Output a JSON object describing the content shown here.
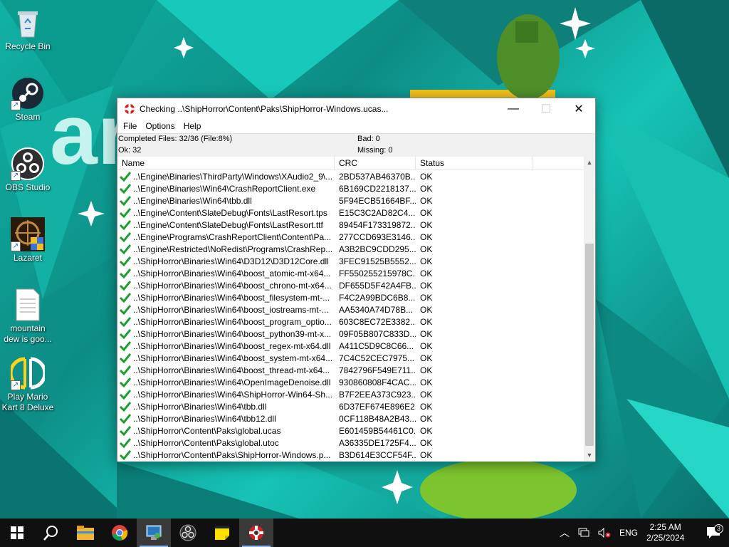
{
  "desktop": {
    "icons": [
      {
        "label": "Recycle Bin",
        "icon": "recycle-bin-icon"
      },
      {
        "label": "Steam",
        "icon": "steam-icon"
      },
      {
        "label": "OBS Studio",
        "icon": "obs-icon"
      },
      {
        "label": "Lazaret",
        "icon": "lazaret-icon"
      },
      {
        "label": "mountain dew is goo...",
        "icon": "text-file-icon"
      },
      {
        "label": "Play Mario Kart 8 Deluxe",
        "icon": "yuzu-icon"
      }
    ]
  },
  "window": {
    "title": "Checking ..\\ShipHorror\\Content\\Paks\\ShipHorror-Windows.ucas...",
    "controls": {
      "minimize": "—",
      "maximize": "☐",
      "close": "✕"
    },
    "menu": [
      "File",
      "Options",
      "Help"
    ],
    "status": {
      "completed": "Completed Files: 32/36 (File:8%)",
      "ok": "Ok: 32",
      "bad": "Bad: 0",
      "missing": "Missing: 0"
    },
    "columns": [
      "Name",
      "CRC",
      "Status"
    ],
    "rows": [
      {
        "name": "..\\Engine\\Binaries\\ThirdParty\\Windows\\XAudio2_9\\...",
        "crc": "2BD537AB46370B...",
        "status": "OK"
      },
      {
        "name": "..\\Engine\\Binaries\\Win64\\CrashReportClient.exe",
        "crc": "6B169CD2218137...",
        "status": "OK"
      },
      {
        "name": "..\\Engine\\Binaries\\Win64\\tbb.dll",
        "crc": "5F94ECB51664BF...",
        "status": "OK"
      },
      {
        "name": "..\\Engine\\Content\\SlateDebug\\Fonts\\LastResort.tps",
        "crc": "E15C3C2AD82C4...",
        "status": "OK"
      },
      {
        "name": "..\\Engine\\Content\\SlateDebug\\Fonts\\LastResort.ttf",
        "crc": "89454F173319872...",
        "status": "OK"
      },
      {
        "name": "..\\Engine\\Programs\\CrashReportClient\\Content\\Pa...",
        "crc": "277CCD693E3146...",
        "status": "OK"
      },
      {
        "name": "..\\Engine\\Restricted\\NoRedist\\Programs\\CrashRep...",
        "crc": "A3B2BC9CDD295...",
        "status": "OK"
      },
      {
        "name": "..\\ShipHorror\\Binaries\\Win64\\D3D12\\D3D12Core.dll",
        "crc": "3FEC91525B5552...",
        "status": "OK"
      },
      {
        "name": "..\\ShipHorror\\Binaries\\Win64\\boost_atomic-mt-x64...",
        "crc": "FF550255215978C...",
        "status": "OK"
      },
      {
        "name": "..\\ShipHorror\\Binaries\\Win64\\boost_chrono-mt-x64...",
        "crc": "DF655D5F42A4FB...",
        "status": "OK"
      },
      {
        "name": "..\\ShipHorror\\Binaries\\Win64\\boost_filesystem-mt-...",
        "crc": "F4C2A99BDC6B8...",
        "status": "OK"
      },
      {
        "name": "..\\ShipHorror\\Binaries\\Win64\\boost_iostreams-mt-...",
        "crc": "AA5340A74D78B...",
        "status": "OK"
      },
      {
        "name": "..\\ShipHorror\\Binaries\\Win64\\boost_program_optio...",
        "crc": "603C8EC72E3382...",
        "status": "OK"
      },
      {
        "name": "..\\ShipHorror\\Binaries\\Win64\\boost_python39-mt-x...",
        "crc": "09F05B807C833D...",
        "status": "OK"
      },
      {
        "name": "..\\ShipHorror\\Binaries\\Win64\\boost_regex-mt-x64.dll",
        "crc": "A411C5D9C8C66...",
        "status": "OK"
      },
      {
        "name": "..\\ShipHorror\\Binaries\\Win64\\boost_system-mt-x64...",
        "crc": "7C4C52CEC7975...",
        "status": "OK"
      },
      {
        "name": "..\\ShipHorror\\Binaries\\Win64\\boost_thread-mt-x64...",
        "crc": "7842796F549E711...",
        "status": "OK"
      },
      {
        "name": "..\\ShipHorror\\Binaries\\Win64\\OpenImageDenoise.dll",
        "crc": "930860808F4CAC...",
        "status": "OK"
      },
      {
        "name": "..\\ShipHorror\\Binaries\\Win64\\ShipHorror-Win64-Sh...",
        "crc": "B7F2EEA373C923...",
        "status": "OK"
      },
      {
        "name": "..\\ShipHorror\\Binaries\\Win64\\tbb.dll",
        "crc": "6D37EF674E896E2...",
        "status": "OK"
      },
      {
        "name": "..\\ShipHorror\\Binaries\\Win64\\tbb12.dll",
        "crc": "0CF118B48A2B43...",
        "status": "OK"
      },
      {
        "name": "..\\ShipHorror\\Content\\Paks\\global.ucas",
        "crc": "E601459B54461C0...",
        "status": "OK"
      },
      {
        "name": "..\\ShipHorror\\Content\\Paks\\global.utoc",
        "crc": "A36335DE1725F4...",
        "status": "OK"
      },
      {
        "name": "..\\ShipHorror\\Content\\Paks\\ShipHorror-Windows.p...",
        "crc": "B3D614E3CCF54F...",
        "status": "OK"
      }
    ]
  },
  "taskbar": {
    "apps": [
      "start-icon",
      "search-icon",
      "file-explorer-icon",
      "chrome-icon",
      "control-panel-icon",
      "obs-icon",
      "sticky-notes-icon",
      "lazaret-icon"
    ],
    "tray": {
      "language": "ENG",
      "time": "2:25 AM",
      "date": "2/25/2024",
      "notifications": "3"
    }
  },
  "colors": {
    "check": "#1e9e2e",
    "accent": "#0078d7",
    "taskbar": "#101010"
  }
}
